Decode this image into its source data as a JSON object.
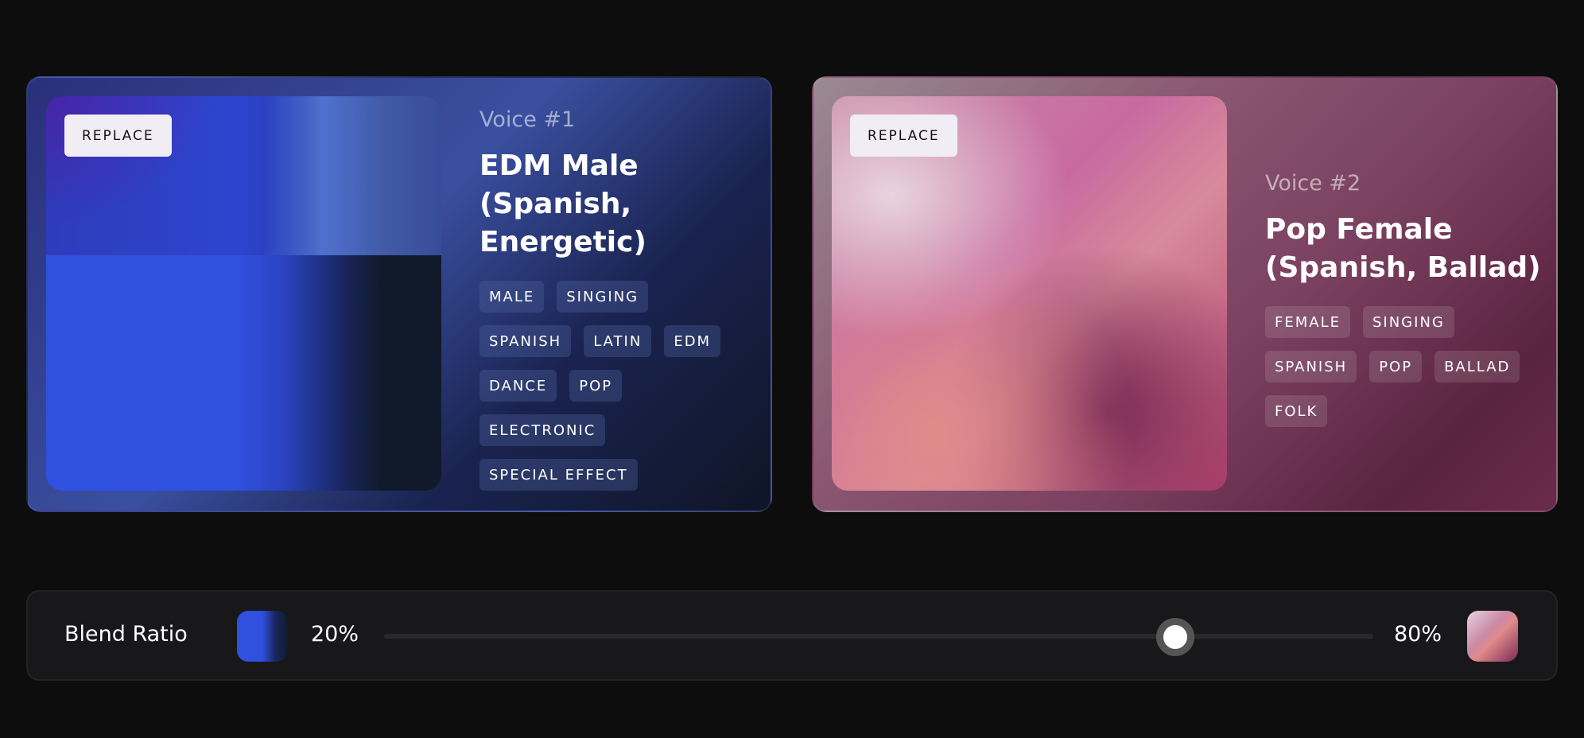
{
  "voice1": {
    "replace_label": "REPLACE",
    "number": "Voice #1",
    "title": "EDM Male (Spanish, Energetic)",
    "tags": [
      "MALE",
      "SINGING",
      "SPANISH",
      "LATIN",
      "EDM",
      "DANCE",
      "POP",
      "ELECTRONIC",
      "SPECIAL EFFECT"
    ]
  },
  "voice2": {
    "replace_label": "REPLACE",
    "number": "Voice #2",
    "title": "Pop Female (Spanish, Ballad)",
    "tags": [
      "FEMALE",
      "SINGING",
      "SPANISH",
      "POP",
      "BALLAD",
      "FOLK"
    ]
  },
  "blend": {
    "label": "Blend Ratio",
    "left_percent": "20%",
    "right_percent": "80%",
    "ratio": 0.8
  }
}
